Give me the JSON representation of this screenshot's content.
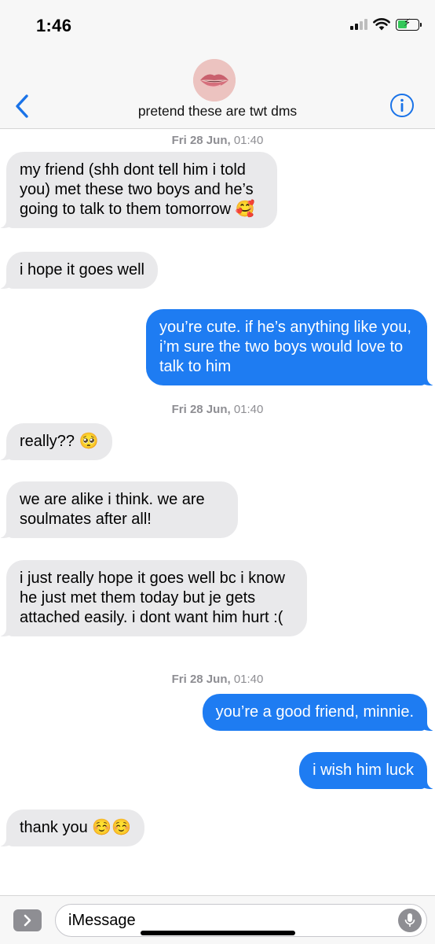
{
  "status_bar": {
    "time": "1:46"
  },
  "header": {
    "contact_name": "pretend these are twt dms",
    "avatar": "lips-photo",
    "back_icon": "chevron-left-icon",
    "info_icon": "info-icon"
  },
  "thread": {
    "timestamps": [
      {
        "day": "Fri 28 Jun,",
        "time": " 01:40"
      },
      {
        "day": "Fri 28 Jun,",
        "time": " 01:40"
      },
      {
        "day": "Fri 28 Jun,",
        "time": " 01:40"
      }
    ],
    "messages": [
      {
        "side": "in",
        "text": "my friend (shh dont tell him i told you) met these two boys and he’s going to talk to them tomorrow 🥰"
      },
      {
        "side": "in",
        "text": "i hope it goes well"
      },
      {
        "side": "out",
        "text": "you’re cute. if he’s anything like you, i’m sure the two boys would love to talk to him"
      },
      {
        "side": "in",
        "text": "really?? 🥺"
      },
      {
        "side": "in",
        "text": "we are alike i think. we are soulmates after all!"
      },
      {
        "side": "in",
        "text": "i just really hope it goes well bc i know he just met them today but je gets attached easily. i dont want him hurt :("
      },
      {
        "side": "out",
        "text": "you’re a good friend, minnie."
      },
      {
        "side": "out",
        "text": "i wish him luck"
      },
      {
        "side": "in",
        "text": "thank you ☺️☺️"
      }
    ]
  },
  "composer": {
    "placeholder": "iMessage"
  },
  "colors": {
    "accent": "#1e7cf2",
    "incoming": "#e9e9eb",
    "timestamp": "#8e8e93"
  }
}
